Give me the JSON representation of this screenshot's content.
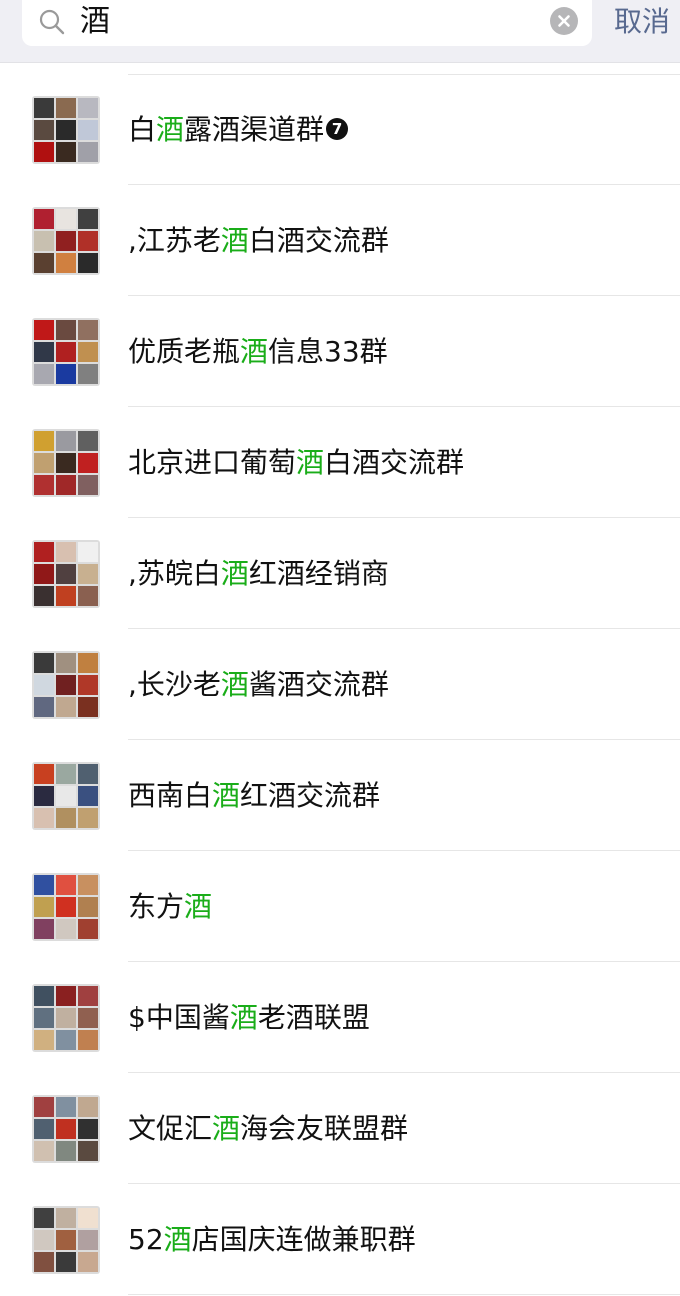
{
  "search": {
    "query": "酒",
    "cancel_label": "取消"
  },
  "colors": {
    "highlight": "#1aad19",
    "cancel": "#58698f",
    "bar_background": "#efeff4"
  },
  "results": [
    {
      "prefix": "白",
      "match": "酒",
      "suffix": "露酒渠道群",
      "badge": "7",
      "avatar_colors": [
        "#3a3a3a",
        "#8a6a50",
        "#b8b8c0",
        "#5a4a40",
        "#2a2a2a",
        "#c0c8d8",
        "#b01010",
        "#3a2a20",
        "#a0a0a8"
      ]
    },
    {
      "prefix": ",江苏老",
      "match": "酒",
      "suffix": "白酒交流群",
      "avatar_colors": [
        "#b02030",
        "#e8e4e0",
        "#404040",
        "#c8c0b0",
        "#902020",
        "#b03028",
        "#5a4030",
        "#d08040",
        "#2a2a2a"
      ]
    },
    {
      "prefix": "优质老瓶",
      "match": "酒",
      "suffix": "信息33群",
      "avatar_colors": [
        "#c01818",
        "#6a4a40",
        "#907060",
        "#303848",
        "#b02020",
        "#c09050",
        "#a8a8b0",
        "#1a3aa0",
        "#808080"
      ]
    },
    {
      "prefix": "北京进口葡萄",
      "match": "酒",
      "suffix": "白酒交流群",
      "avatar_colors": [
        "#d0a030",
        "#9a9aa0",
        "#606060",
        "#c0a070",
        "#3a2a20",
        "#c02020",
        "#b03030",
        "#a02828",
        "#806060"
      ]
    },
    {
      "prefix": ",苏皖白",
      "match": "酒",
      "suffix": "红酒经销商",
      "avatar_colors": [
        "#b02020",
        "#d8c0b0",
        "#f0f0f0",
        "#901818",
        "#504040",
        "#c8b090",
        "#3a3030",
        "#c04020",
        "#8a6050"
      ]
    },
    {
      "prefix": ",长沙老",
      "match": "酒",
      "suffix": "酱酒交流群",
      "avatar_colors": [
        "#3a3a3a",
        "#a09080",
        "#c08040",
        "#d0d8e0",
        "#702020",
        "#b03828",
        "#606880",
        "#c0a890",
        "#7a3020"
      ]
    },
    {
      "prefix": "西南白",
      "match": "酒",
      "suffix": "红酒交流群",
      "avatar_colors": [
        "#c84020",
        "#9aa8a0",
        "#506070",
        "#2a2a40",
        "#e8e8e8",
        "#3a5080",
        "#d8c0b0",
        "#b09060",
        "#c0a070"
      ]
    },
    {
      "prefix": "东方",
      "match": "酒",
      "suffix": "",
      "avatar_colors": [
        "#3050a0",
        "#e05040",
        "#c89060",
        "#c0a050",
        "#d03020",
        "#b08050",
        "#804060",
        "#d0c8c0",
        "#a04030"
      ]
    },
    {
      "prefix": "$中国酱",
      "match": "酒",
      "suffix": "老酒联盟",
      "avatar_colors": [
        "#405060",
        "#8a2020",
        "#a04040",
        "#607080",
        "#c0b0a0",
        "#906050",
        "#d0b080",
        "#8090a0",
        "#c08050"
      ]
    },
    {
      "prefix": "文促汇",
      "match": "酒",
      "suffix": "海会友联盟群",
      "avatar_colors": [
        "#a04040",
        "#8090a0",
        "#c0a890",
        "#506070",
        "#c03020",
        "#303030",
        "#d0c0b0",
        "#808880",
        "#5a4a40"
      ]
    },
    {
      "prefix": "52",
      "match": "酒",
      "suffix": "店国庆连做兼职群",
      "avatar_colors": [
        "#404040",
        "#c0b0a0",
        "#f0e0d0",
        "#d0c8c0",
        "#a06040",
        "#b0a0a0",
        "#805040",
        "#3a3a3a",
        "#c8a890"
      ]
    }
  ]
}
